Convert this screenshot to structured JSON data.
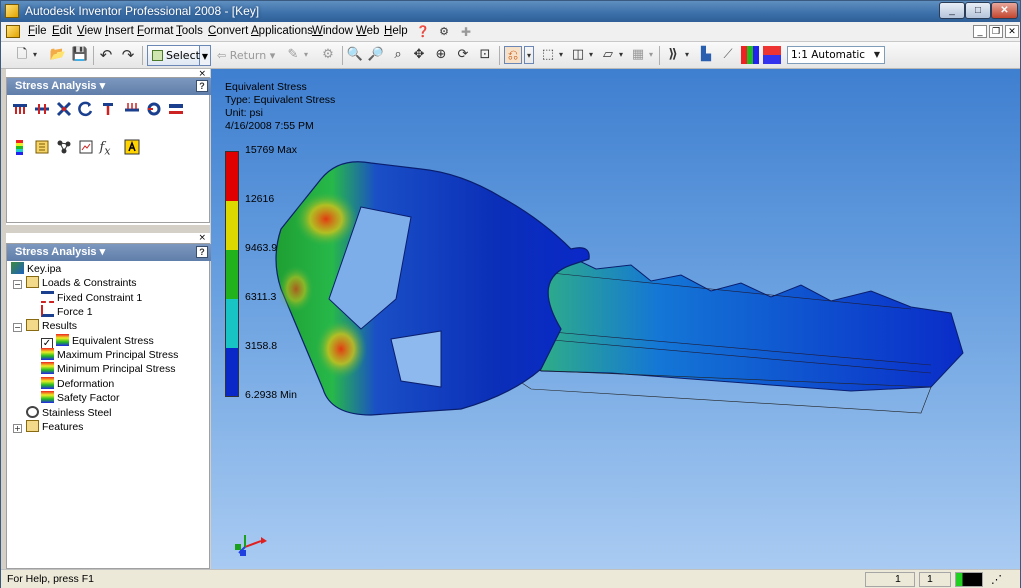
{
  "window": {
    "title": "Autodesk Inventor Professional 2008 - [Key]",
    "caption_buttons": [
      "_",
      "□",
      "✕"
    ]
  },
  "menu": {
    "items": [
      "File",
      "Edit",
      "View",
      "Insert",
      "Format",
      "Tools",
      "Convert",
      "Applications",
      "Window",
      "Web",
      "Help"
    ],
    "mdi_buttons": [
      "_",
      "❐",
      "✕"
    ]
  },
  "toolbar": {
    "select_label": "Select",
    "return_label": "Return",
    "view_scale": "1:1 Automatic",
    "icons": [
      "new-icon",
      "open-icon",
      "save-icon",
      "undo-icon",
      "redo-icon",
      "zoom-all-icon",
      "zoom-window-icon",
      "zoom-icon",
      "pan-icon",
      "zoom-selected-icon",
      "orbit-icon",
      "look-at-icon",
      "display-mode-icon",
      "shaded-icon",
      "camera-icon",
      "ground-shadow-icon",
      "section-icon",
      "iproperties-icon",
      "color-icon",
      "color-style-icon"
    ]
  },
  "panel_top": {
    "title": "Stress Analysis",
    "help": "?",
    "close": "×"
  },
  "panel_bottom": {
    "title": "Stress Analysis",
    "help": "?",
    "close": "×"
  },
  "browser": {
    "root": "Key.ipa",
    "loads": "Loads & Constraints",
    "fixed": "Fixed Constraint 1",
    "force": "Force 1",
    "results": "Results",
    "equivalent": "Equivalent Stress",
    "max_principal": "Maximum Principal Stress",
    "min_principal": "Minimum Principal Stress",
    "deformation": "Deformation",
    "safety": "Safety Factor",
    "material": "Stainless Steel",
    "features": "Features"
  },
  "viewport": {
    "info_title": "Equivalent Stress",
    "info_type": "Type: Equivalent Stress",
    "info_unit": "Unit: psi",
    "info_date": "4/16/2008 7:55 PM",
    "legend": {
      "max": "15769 Max",
      "t1": "12616",
      "t2": "9463.9",
      "t3": "6311.3",
      "t4": "3158.8",
      "min": "6.2938 Min",
      "colors": [
        "#e00000",
        "#dcd800",
        "#21b21c",
        "#19c4c4",
        "#0a28c8"
      ]
    }
  },
  "status": {
    "help": "For Help, press F1",
    "count1": "1",
    "count2": "1"
  }
}
